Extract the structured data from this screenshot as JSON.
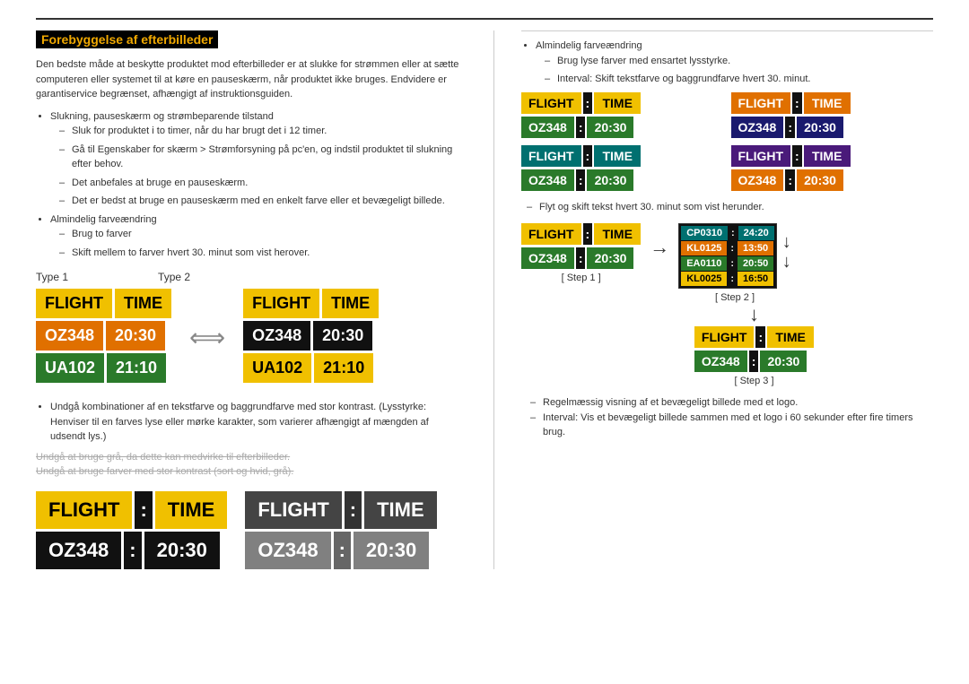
{
  "title": "Forebyggelse af efterbilleder",
  "top_paragraph": "Den bedste måde at beskytte produktet mod efterbilleder er at slukke for strømmen eller at sætte computeren eller systemet til at køre en pauseskærm, når produktet ikke bruges. Endvidere er garantiservice begrænset, afhængigt af instruktionsguiden.",
  "bullet1": "Slukning, pauseskærm og strømbeparende tilstand",
  "dash1": "Sluk for produktet i to timer, når du har brugt det i 12 timer.",
  "dash2": "Gå til Egenskaber for skærm > Strømforsyning på pc'en, og indstil produktet til slukning efter behov.",
  "dash3": "Det anbefales at bruge en pauseskærm.",
  "dash3b": "Det er bedst at bruge en pauseskærm med en enkelt farve eller et bevægeligt billede.",
  "bullet2": "Almindelig farveændring",
  "dash4": "Brug to farver",
  "dash4b": "Skift mellem to farver hvert 30. minut som vist herover.",
  "type1_label": "Type 1",
  "type2_label": "Type 2",
  "board1": {
    "header": [
      "FLIGHT",
      "TIME"
    ],
    "rows": [
      [
        "OZ348",
        "20:30"
      ],
      [
        "UA102",
        "21:10"
      ]
    ]
  },
  "board2": {
    "header": [
      "FLIGHT",
      "TIME"
    ],
    "rows": [
      [
        "OZ348",
        "20:30"
      ],
      [
        "UA102",
        "21:10"
      ]
    ]
  },
  "avoid_text": "Undgå kombinationer af en tekstfarve og baggrundfarve med stor kontrast. (Lysstyrke: Henviser til en farves lyse eller mørke karakter, som varierer afhængigt af mængden af udsendt lys.)",
  "grayed1": "Undgå at bruge grå, da dette kan medvirke til efterbilleder.",
  "grayed2": "Undgå at bruge farver med stor kontrast (sort og hvid, grå).",
  "large_board1": {
    "header": [
      "FLIGHT",
      "TIME"
    ],
    "row": [
      "OZ348",
      "20:30"
    ],
    "bg_header": [
      "yellow",
      "yellow"
    ],
    "bg_row": [
      "black",
      "black"
    ]
  },
  "large_board2": {
    "header": [
      "FLIGHT",
      "TIME"
    ],
    "row": [
      "OZ348",
      "20:30"
    ],
    "bg_header": [
      "dark",
      "dark"
    ],
    "bg_row": [
      "gray",
      "gray"
    ]
  },
  "right_bullet1": "Almindelig farveændring",
  "right_dash1": "Brug lyse farver med ensartet lysstyrke.",
  "right_dash1b": "Interval: Skift tekstfarve og baggrundfarve hvert 30. minut.",
  "sm_boards": [
    {
      "header_bg": [
        "yellow",
        "yellow"
      ],
      "row_bg": [
        "green",
        "green"
      ],
      "header": [
        "FLIGHT",
        "TIME"
      ],
      "row": [
        "OZ348",
        "20:30"
      ]
    },
    {
      "header_bg": [
        "orange",
        "orange"
      ],
      "row_bg": [
        "darkblue",
        "darkblue"
      ],
      "header": [
        "FLIGHT",
        "TIME"
      ],
      "row": [
        "OZ348",
        "20:30"
      ]
    },
    {
      "header_bg": [
        "teal",
        "teal"
      ],
      "row_bg": [
        "green",
        "green"
      ],
      "header": [
        "FLIGHT",
        "TIME"
      ],
      "row": [
        "OZ348",
        "20:30"
      ]
    },
    {
      "header_bg": [
        "purple",
        "purple"
      ],
      "row_bg": [
        "orange",
        "orange"
      ],
      "header": [
        "FLIGHT",
        "TIME"
      ],
      "row": [
        "OZ348",
        "20:30"
      ]
    }
  ],
  "right_dash2": "Flyt og skift tekst hvert 30. minut som vist herunder.",
  "step1_label": "[ Step 1 ]",
  "step2_label": "[ Step 2 ]",
  "step3_label": "[ Step 3 ]",
  "scroll_rows": [
    [
      "CP0310",
      "24:20"
    ],
    [
      "KL0125",
      "13:50"
    ],
    [
      "EA0110",
      "20:50"
    ],
    [
      "KL0025",
      "16:50"
    ]
  ],
  "step1_board": {
    "header": [
      "FLIGHT",
      "TIME"
    ],
    "row": [
      "OZ348",
      "20:30"
    ]
  },
  "step3_board": {
    "header": [
      "FLIGHT",
      "TIME"
    ],
    "row": [
      "OZ348",
      "20:30"
    ]
  },
  "right_dash3": "Regelmæssig visning af et bevægeligt billede med et logo.",
  "right_dash3b": "Interval: Vis et bevægeligt billede sammen med et logo i 60 sekunder efter fire timers brug."
}
